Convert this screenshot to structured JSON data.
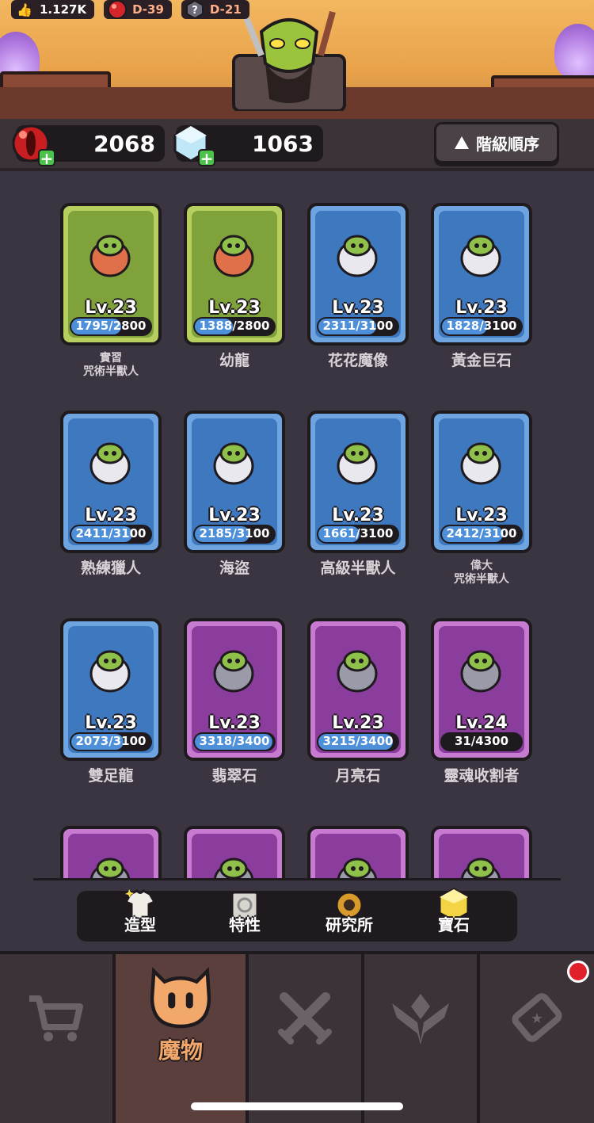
{
  "top_stats": {
    "likes": "1.127K",
    "badge_red": "D-39",
    "badge_gray": "D-21"
  },
  "resources": {
    "red_gem": "2068",
    "crystal": "1063",
    "sort_label": "階級順序",
    "sort_icon": "triangle-up-icon"
  },
  "monsters": [
    {
      "level": "Lv.23",
      "progress": "1795/2800",
      "fraction": 0.641,
      "name": "實習\n咒術半獸人",
      "rarity": "green",
      "small": true
    },
    {
      "level": "Lv.23",
      "progress": "1388/2800",
      "fraction": 0.496,
      "name": "幼龍",
      "rarity": "green"
    },
    {
      "level": "Lv.23",
      "progress": "2311/3100",
      "fraction": 0.745,
      "name": "花花魔像",
      "rarity": "blue"
    },
    {
      "level": "Lv.23",
      "progress": "1828/3100",
      "fraction": 0.59,
      "name": "黃金巨石",
      "rarity": "blue"
    },
    {
      "level": "Lv.23",
      "progress": "2411/3100",
      "fraction": 0.778,
      "name": "熟練獵人",
      "rarity": "blue"
    },
    {
      "level": "Lv.23",
      "progress": "2185/3100",
      "fraction": 0.705,
      "name": "海盜",
      "rarity": "blue"
    },
    {
      "level": "Lv.23",
      "progress": "1661/3100",
      "fraction": 0.536,
      "name": "高級半獸人",
      "rarity": "blue"
    },
    {
      "level": "Lv.23",
      "progress": "2412/3100",
      "fraction": 0.778,
      "name": "偉大\n咒術半獸人",
      "rarity": "blue",
      "small": true
    },
    {
      "level": "Lv.23",
      "progress": "2073/3100",
      "fraction": 0.669,
      "name": "雙足龍",
      "rarity": "blue"
    },
    {
      "level": "Lv.23",
      "progress": "3318/3400",
      "fraction": 0.976,
      "name": "翡翠石",
      "rarity": "purple"
    },
    {
      "level": "Lv.23",
      "progress": "3215/3400",
      "fraction": 0.946,
      "name": "月亮石",
      "rarity": "purple"
    },
    {
      "level": "Lv.24",
      "progress": "31/4300",
      "fraction": 0.007,
      "name": "靈魂收割者",
      "rarity": "purple"
    },
    {
      "level": "",
      "progress": "",
      "fraction": 0,
      "name": "",
      "rarity": "purple"
    },
    {
      "level": "",
      "progress": "",
      "fraction": 0,
      "name": "",
      "rarity": "purple"
    },
    {
      "level": "",
      "progress": "",
      "fraction": 0,
      "name": "",
      "rarity": "purple"
    },
    {
      "level": "",
      "progress": "",
      "fraction": 0,
      "name": "",
      "rarity": "purple"
    }
  ],
  "sub_tabs": [
    {
      "label": "造型",
      "icon": "shirt-icon"
    },
    {
      "label": "特性",
      "icon": "scroll-icon"
    },
    {
      "label": "研究所",
      "icon": "gear-icon"
    },
    {
      "label": "寶石",
      "icon": "gem-icon"
    }
  ],
  "bottom_nav": [
    {
      "label": "",
      "icon": "cart-icon"
    },
    {
      "label": "魔物",
      "icon": "monster-icon",
      "active": true
    },
    {
      "label": "",
      "icon": "crossed-swords-icon"
    },
    {
      "label": "",
      "icon": "rank-wings-icon"
    },
    {
      "label": "",
      "icon": "ticket-icon"
    }
  ],
  "colors": {
    "background": "#3a3540",
    "accent": "#f3a86b",
    "progress_fill": "#4d8fd8",
    "green_card": "#b7cf5f",
    "blue_card": "#6ea4e0",
    "purple_card": "#c67bd0",
    "notification": "#e0202a"
  }
}
